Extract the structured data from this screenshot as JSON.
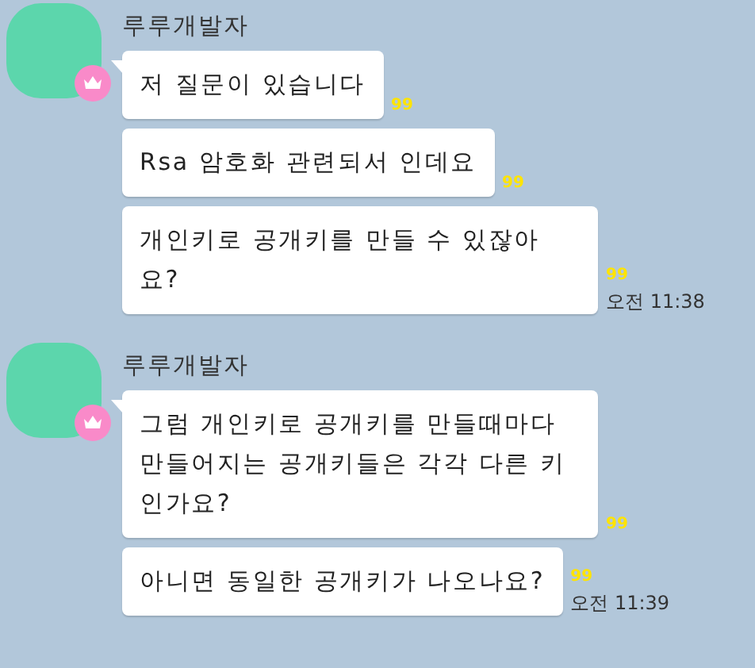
{
  "groups": [
    {
      "sender": "루루개발자",
      "messages": [
        {
          "text": "저 질문이 있습니다",
          "unread": "99"
        },
        {
          "text": "Rsa 암호화 관련되서 인데요",
          "unread": "99"
        },
        {
          "text": "개인키로 공개키를 만들 수 있잖아요?",
          "unread": "99",
          "time": "오전 11:38"
        }
      ]
    },
    {
      "sender": "루루개발자",
      "messages": [
        {
          "text": "그럼 개인키로 공개키를 만들때마다 만들어지는 공개키들은 각각 다른 키인가요?",
          "unread": "99"
        },
        {
          "text": "아니면 동일한 공개키가 나오나요?",
          "unread": "99",
          "time": "오전 11:39"
        }
      ]
    }
  ]
}
